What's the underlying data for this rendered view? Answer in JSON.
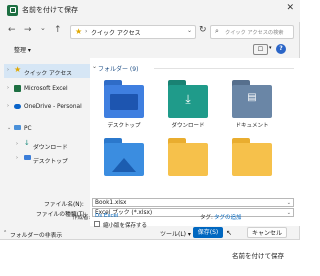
{
  "window": {
    "title": "名前を付けて保存",
    "close": "✕"
  },
  "toolbar": {
    "back": "←",
    "forward": "→",
    "up_chevron": "⌄",
    "up": "↑",
    "address_text": "クイック アクセス",
    "address_sep": "›",
    "refresh": "↻",
    "search_placeholder": "クイック アクセスの検索"
  },
  "cmdbar": {
    "organize_label": "整理 ▾",
    "view_icon": "☐",
    "help": "?"
  },
  "nav": {
    "items": [
      {
        "label": "クイック アクセス",
        "icon_color": "#e0a800"
      },
      {
        "label": "Microsoft Excel",
        "icon_color": "#1d6f42"
      },
      {
        "label": "OneDrive - Personal",
        "icon_color": "#0a64c9"
      },
      {
        "label": "PC",
        "icon_color": "#4a90d9"
      },
      {
        "label": "ダウンロード",
        "icon_color": "#1a8a7d"
      },
      {
        "label": "デスクトップ",
        "icon_color": "#3b7dd8"
      }
    ]
  },
  "content": {
    "group_header": "フォルダー (9)",
    "folders": [
      {
        "label": "デスクトップ",
        "icon": "desktop-icon",
        "color": "#3f7fe0"
      },
      {
        "label": "ダウンロード",
        "icon": "download-icon",
        "color": "#1f9b8a"
      },
      {
        "label": "ドキュメント",
        "icon": "document-icon",
        "color": "#6a86a6"
      },
      {
        "label": "",
        "icon": "pictures-icon",
        "color": "#3b8de0"
      },
      {
        "label": "",
        "icon": "folder-icon",
        "color": "#f6c14b"
      },
      {
        "label": "",
        "icon": "folder-icon",
        "color": "#f6c14b"
      }
    ]
  },
  "form": {
    "filename_label": "ファイル名(N):",
    "filename_value": "Book1.xlsx",
    "filetype_label": "ファイルの種類(T):",
    "filetype_value": "Excel ブック (*.xlsx)",
    "author_label": "作成者:",
    "author_value": "Ds Excel",
    "tags_label": "タグ:",
    "tags_value": "タグの追加",
    "thumbnail_label": "縮小版を保存する"
  },
  "footer": {
    "hide_folders": "フォルダーの非表示",
    "tools": "ツール(L) ▾",
    "save": "保存(S)",
    "cancel": "キャンセル"
  },
  "caption": "名前を付けて保存"
}
